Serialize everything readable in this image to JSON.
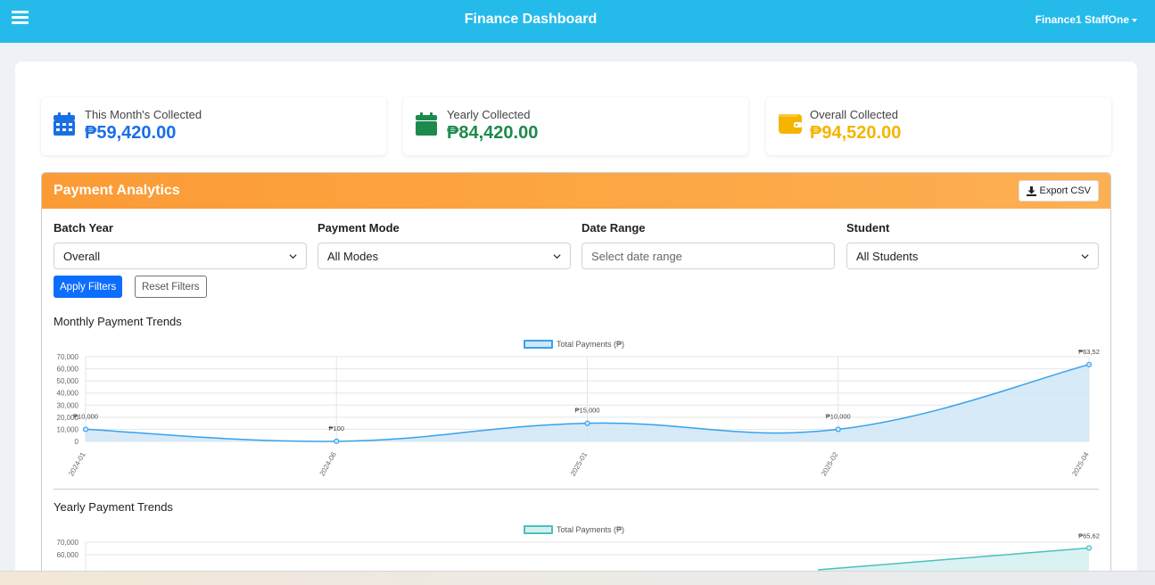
{
  "header": {
    "menu_icon": "hamburger-icon",
    "title": "Finance Dashboard",
    "user": "Finance1 StaffOne"
  },
  "stats": [
    {
      "label": "This Month's Collected",
      "value": "₱59,420.00",
      "icon": "calendar-days-icon",
      "color": "#1a6ee6"
    },
    {
      "label": "Yearly Collected",
      "value": "₱84,420.00",
      "icon": "calendar-icon",
      "color": "#1d8a4c"
    },
    {
      "label": "Overall Collected",
      "value": "₱94,520.00",
      "icon": "wallet-icon",
      "color": "#f5b400"
    }
  ],
  "analytics": {
    "title": "Payment Analytics",
    "export_label": "Export CSV",
    "export_icon": "download-icon",
    "filters": {
      "batch_year": {
        "label": "Batch Year",
        "value": "Overall"
      },
      "payment_mode": {
        "label": "Payment Mode",
        "value": "All Modes"
      },
      "date_range": {
        "label": "Date Range",
        "placeholder": "Select date range"
      },
      "student": {
        "label": "Student",
        "value": "All Students"
      }
    },
    "apply_label": "Apply Filters",
    "reset_label": "Reset Filters",
    "monthly_title": "Monthly Payment Trends",
    "yearly_title": "Yearly Payment Trends"
  },
  "chart_data": [
    {
      "type": "area",
      "title": "Monthly Payment Trends",
      "legend": "Total Payments (₱)",
      "legend_position": "top-center",
      "color": "#36a2eb",
      "fill": "#cfe6f7",
      "x": [
        "2024-01",
        "2024-06",
        "2025-01",
        "2025-02",
        "2025-04"
      ],
      "values": [
        10000,
        100,
        15000,
        10000,
        63520
      ],
      "data_labels": [
        "₱10,000",
        "₱100",
        "₱15,000",
        "₱10,000",
        "₱63,52"
      ],
      "yticks": [
        "0",
        "10,000",
        "20,000",
        "30,000",
        "40,000",
        "50,000",
        "60,000",
        "70,000"
      ],
      "ylim": [
        0,
        70000
      ],
      "grid": true
    },
    {
      "type": "area",
      "title": "Yearly Payment Trends",
      "legend": "Total Payments (₱)",
      "legend_position": "top-center",
      "color": "#4bc0c0",
      "fill": "#d3f0ef",
      "values": [
        65620
      ],
      "data_labels": [
        "₱65,62"
      ],
      "yticks": [
        "70,000",
        "60,000"
      ],
      "ylim": [
        0,
        70000
      ],
      "grid": true
    }
  ]
}
